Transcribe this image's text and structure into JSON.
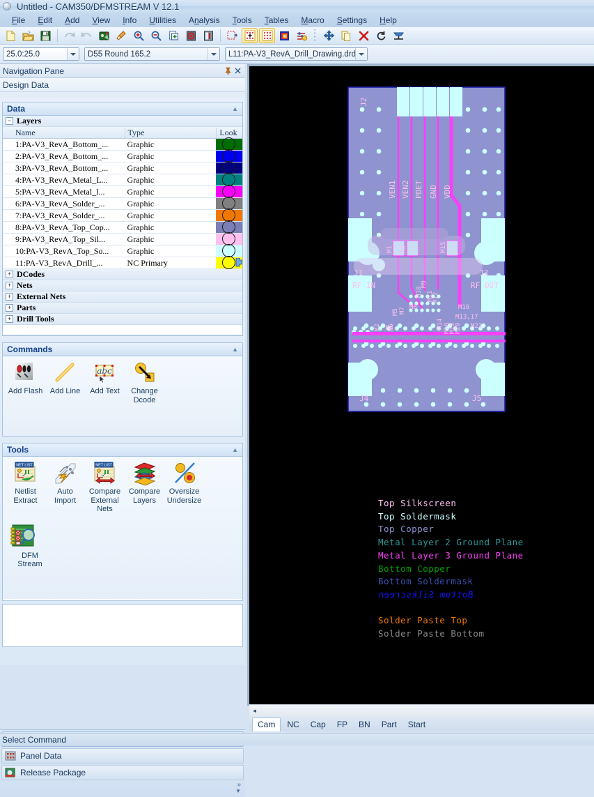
{
  "window": {
    "title": "Untitled - CAM350/DFMSTREAM V 12.1",
    "icon": "app-sphere-icon"
  },
  "menubar": {
    "items": [
      {
        "label": "File",
        "accel": "F"
      },
      {
        "label": "Edit",
        "accel": "E"
      },
      {
        "label": "Add",
        "accel": "A"
      },
      {
        "label": "View",
        "accel": "V"
      },
      {
        "label": "Info",
        "accel": "I"
      },
      {
        "label": "Utilities",
        "accel": "U"
      },
      {
        "label": "Analysis",
        "accel": "n"
      },
      {
        "label": "Tools",
        "accel": "T"
      },
      {
        "label": "Tables",
        "accel": "T"
      },
      {
        "label": "Macro",
        "accel": "M"
      },
      {
        "label": "Settings",
        "accel": "S"
      },
      {
        "label": "Help",
        "accel": "H"
      }
    ]
  },
  "toolbar": {
    "buttons": [
      {
        "name": "new-file-icon",
        "pressed": false
      },
      {
        "name": "open-file-icon",
        "pressed": false
      },
      {
        "name": "save-file-icon",
        "pressed": false
      },
      {
        "name": "undo-icon",
        "pressed": false
      },
      {
        "name": "redo-icon",
        "pressed": false
      },
      {
        "name": "redraw-icon",
        "pressed": false
      },
      {
        "name": "clean-icon",
        "pressed": false
      },
      {
        "name": "zoom-in-icon",
        "pressed": false
      },
      {
        "name": "zoom-out-icon",
        "pressed": false
      },
      {
        "name": "zoom-window-icon",
        "pressed": false
      },
      {
        "name": "zoom-home-icon",
        "pressed": false
      },
      {
        "name": "zoom-previous-icon",
        "pressed": false
      },
      {
        "name": "grid-snap-icon",
        "pressed": false
      },
      {
        "name": "display-grid-icon",
        "pressed": true
      },
      {
        "name": "grid-points-icon",
        "pressed": true
      },
      {
        "name": "color-palette-icon",
        "pressed": false
      },
      {
        "name": "layer-settings-icon",
        "pressed": false
      },
      {
        "name": "move-icon",
        "pressed": false
      },
      {
        "name": "copy-icon",
        "pressed": false
      },
      {
        "name": "delete-icon",
        "pressed": false
      },
      {
        "name": "rotate-icon",
        "pressed": false
      },
      {
        "name": "mirror-icon",
        "pressed": false
      }
    ]
  },
  "combobar": {
    "zoom_ratio": "25.0:25.0",
    "dcode": "D55   Round 165.2",
    "layer": "L11:PA-V3_RevA_Drill_Drawing.drd"
  },
  "navpane": {
    "header_title": "Navigation Pane",
    "pin_icon": "pin-icon",
    "close_icon": "close-icon",
    "subtitle": "Design Data",
    "groups": {
      "data": {
        "title": "Data",
        "layers_node": "Layers",
        "columns": [
          "Name",
          "Type",
          "Look"
        ],
        "layers": [
          {
            "name": "1:PA-V3_RevA_Bottom_...",
            "type": "Graphic",
            "color": "#006d00"
          },
          {
            "name": "2:PA-V3_RevA_Bottom_...",
            "type": "Graphic",
            "color": "#0000f0"
          },
          {
            "name": "3:PA-V3_RevA_Bottom_...",
            "type": "Graphic",
            "color": "#000080"
          },
          {
            "name": "4:PA-V3_RevA_Metal_L...",
            "type": "Graphic",
            "color": "#008080"
          },
          {
            "name": "5:PA-V3_RevA_Metal_l...",
            "type": "Graphic",
            "color": "#f800f8"
          },
          {
            "name": "6:PA-V3_RevA_Solder_...",
            "type": "Graphic",
            "color": "#808080"
          },
          {
            "name": "7:PA-V3_RevA_Solder_...",
            "type": "Graphic",
            "color": "#f07800"
          },
          {
            "name": "8:PA-V3_RevA_Top_Cop...",
            "type": "Graphic",
            "color": "#7b7fb5"
          },
          {
            "name": "9:PA-V3_RevA_Top_Sil...",
            "type": "Graphic",
            "color": "#ffc0f0"
          },
          {
            "name": "10:PA-V3_RevA_Top_So...",
            "type": "Graphic",
            "color": "#ccffff"
          },
          {
            "name": "11:PA-V3_RevA_Drill_...",
            "type": "NC Primary",
            "color": "#ffff00"
          }
        ],
        "nodes": [
          {
            "label": "DCodes"
          },
          {
            "label": "Nets"
          },
          {
            "label": "External Nets"
          },
          {
            "label": "Parts"
          },
          {
            "label": "Drill Tools"
          }
        ]
      },
      "commands": {
        "title": "Commands",
        "items": [
          {
            "label": "Add Flash",
            "icon": "add-flash-icon"
          },
          {
            "label": "Add Line",
            "icon": "add-line-icon"
          },
          {
            "label": "Add Text",
            "icon": "add-text-icon"
          },
          {
            "label": "Change\nDcode",
            "icon": "change-dcode-icon"
          }
        ]
      },
      "tools": {
        "title": "Tools",
        "items": [
          {
            "label": "Netlist\nExtract",
            "icon": "netlist-extract-icon"
          },
          {
            "label": "Auto\nImport",
            "icon": "auto-import-icon"
          },
          {
            "label": "Compare\nExternal\nNets",
            "icon": "compare-external-nets-icon"
          },
          {
            "label": "Compare\nLayers",
            "icon": "compare-layers-icon"
          },
          {
            "label": "Oversize\nUndersize",
            "icon": "oversize-undersize-icon"
          },
          {
            "label": "DFM Stream",
            "icon": "dfm-stream-icon"
          }
        ]
      }
    },
    "bottom_buttons": [
      {
        "label": "Design Data",
        "icon": "design-data-icon",
        "selected": true
      },
      {
        "label": "Panel Data",
        "icon": "panel-data-icon",
        "selected": false
      },
      {
        "label": "Release Package",
        "icon": "release-package-icon",
        "selected": false
      }
    ],
    "more_chevron": "»"
  },
  "canvas": {
    "background": "#000000",
    "legend": [
      {
        "text": "Top Silkscreen",
        "color": "#ffc0f0",
        "mirrored": false
      },
      {
        "text": "Top Soldermask",
        "color": "#ccffff",
        "mirrored": false
      },
      {
        "text": "Top Copper",
        "color": "#8f93cf",
        "mirrored": false
      },
      {
        "text": "Metal Layer 2 Ground Plane",
        "color": "#2a9b9b",
        "mirrored": false
      },
      {
        "text": "Metal Layer 3 Ground Plane",
        "color": "#f840f8",
        "mirrored": false
      },
      {
        "text": "Bottom Copper",
        "color": "#00a000",
        "mirrored": false
      },
      {
        "text": "Bottom Soldermask",
        "color": "#3b4fb0",
        "mirrored": false
      },
      {
        "text": "Bottom Silkscreen",
        "color": "#1414ff",
        "mirrored": true
      },
      {
        "text": "",
        "color": "#000000",
        "mirrored": false
      },
      {
        "text": "Solder Paste Top",
        "color": "#f07800",
        "mirrored": false
      },
      {
        "text": "Solder Paste Bottom",
        "color": "#8a8a8a",
        "mirrored": false
      }
    ],
    "board": {
      "silkscreen_labels": [
        "J2",
        "J1",
        "J3",
        "J4",
        "J5",
        "RF IN",
        "RF OUT",
        "VEN1",
        "VEN2",
        "PDET",
        "GND",
        "VDD",
        "M1",
        "M3",
        "M15",
        "M9",
        "M10",
        "M11",
        "M12",
        "M8",
        "M5",
        "M7",
        "M16",
        "M13,17",
        "M2",
        "M4",
        "M6",
        "M14",
        "M18",
        "M19",
        "M20",
        "M21"
      ],
      "colors": {
        "copper": "#8f93cf",
        "soldermask": "#ccffff",
        "metal3": "#f840f8",
        "silkscreen": "#ffc0f0",
        "outline": "#2020b0"
      }
    },
    "hscrollbar": {
      "left_arrow": "◄"
    },
    "tabs": [
      {
        "label": "Cam",
        "active": true
      },
      {
        "label": "NC",
        "active": false
      },
      {
        "label": "Cap",
        "active": false
      },
      {
        "label": "FP",
        "active": false
      },
      {
        "label": "BN",
        "active": false
      },
      {
        "label": "Part",
        "active": false
      },
      {
        "label": "Start",
        "active": false
      }
    ]
  },
  "statusbar": {
    "text": "Select Command"
  }
}
